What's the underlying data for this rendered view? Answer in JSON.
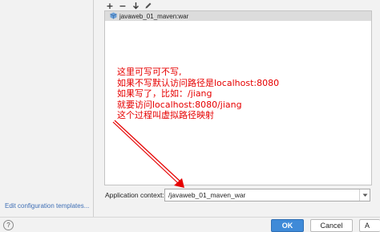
{
  "toolbar": {
    "add_label": "+",
    "remove_label": "−",
    "move_down_icon": "arrow-down-icon",
    "edit_icon": "pencil-icon"
  },
  "artifacts": {
    "items": [
      {
        "label": "javaweb_01_maven:war",
        "icon": "artifact-icon"
      }
    ]
  },
  "annotation": {
    "lines": [
      "这里可写可不写,",
      "如果不写默认访问路径是localhost:8080",
      "如果写了，比如：/jiang",
      "就要访问localhost:8080/jiang",
      "这个过程叫虚拟路径映射"
    ],
    "color": "#e60000"
  },
  "context": {
    "label": "Application context:",
    "value": "/javaweb_01_maven_war"
  },
  "left_panel": {
    "edit_templates": "Edit configuration templates..."
  },
  "bottom": {
    "help_label": "?",
    "ok_label": "OK",
    "cancel_label": "Cancel",
    "apply_label": "A"
  },
  "colors": {
    "accent": "#3f8ad8",
    "selection": "#dcdcdc",
    "link": "#3f6fb5"
  }
}
